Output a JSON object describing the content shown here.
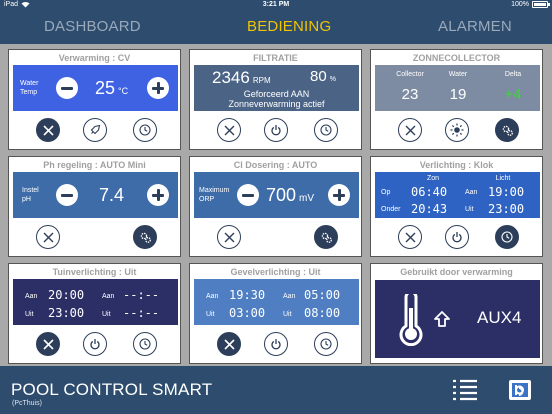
{
  "status": {
    "device": "iPad",
    "time": "3:21 PM",
    "battery": "100%"
  },
  "nav": {
    "tabs": [
      {
        "label": "DASHBOARD"
      },
      {
        "label": "BEDIENING"
      },
      {
        "label": "ALARMEN"
      }
    ]
  },
  "panels": {
    "verwarming": {
      "title": "Verwarming : CV",
      "label_l1": "Water",
      "label_l2": "Temp",
      "value": "25",
      "unit": "°C"
    },
    "filtratie": {
      "title": "FILTRATIE",
      "rpm": "2346",
      "rpm_unit": "RPM",
      "percent": "80",
      "percent_unit": "%",
      "line1": "Geforceerd AAN",
      "line2": "Zonneverwarming actief"
    },
    "zonnecollector": {
      "title": "ZONNECOLLECTOR",
      "col_labels": [
        "Collector",
        "Water",
        "Delta"
      ],
      "col_values": [
        "23",
        "19",
        "+4"
      ]
    },
    "ph": {
      "title": "Ph regeling : AUTO Mini",
      "label_l1": "Instel",
      "label_l2": "pH",
      "value": "7.4"
    },
    "cl": {
      "title": "Cl Dosering : AUTO",
      "label_l1": "Maximum",
      "label_l2": "ORP",
      "value": "700",
      "unit": "mV"
    },
    "verlichting": {
      "title": "Verlichting : Klok",
      "head_zon": "Zon",
      "head_licht": "Licht",
      "op_label": "Op",
      "op_time": "06:40",
      "onder_label": "Onder",
      "onder_time": "20:43",
      "aan_label": "Aan",
      "aan_time": "19:00",
      "uit_label": "Uit",
      "uit_time": "23:00"
    },
    "tuin": {
      "title": "Tuinverlichting : Uit",
      "aan1_label": "Aan",
      "aan1_time": "20:00",
      "uit1_label": "Uit",
      "uit1_time": "23:00",
      "aan2_label": "Aan",
      "aan2_time": "--:--",
      "uit2_label": "Uit",
      "uit2_time": "--:--"
    },
    "gevel": {
      "title": "Gevelverlichting : Uit",
      "aan1_label": "Aan",
      "aan1_time": "19:30",
      "uit1_label": "Uit",
      "uit1_time": "03:00",
      "aan2_label": "Aan",
      "aan2_time": "05:00",
      "uit2_label": "Uit",
      "uit2_time": "08:00"
    },
    "gebruikt": {
      "title": "Gebruikt door verwarming",
      "aux": "AUX4"
    }
  },
  "footer": {
    "brand": "POOL CONTROL SMART",
    "sub": "(PcThuis)"
  },
  "colors": {
    "bar": "#2e4c6e",
    "active_tab": "#f0c400",
    "button": "#2c3e5a"
  }
}
